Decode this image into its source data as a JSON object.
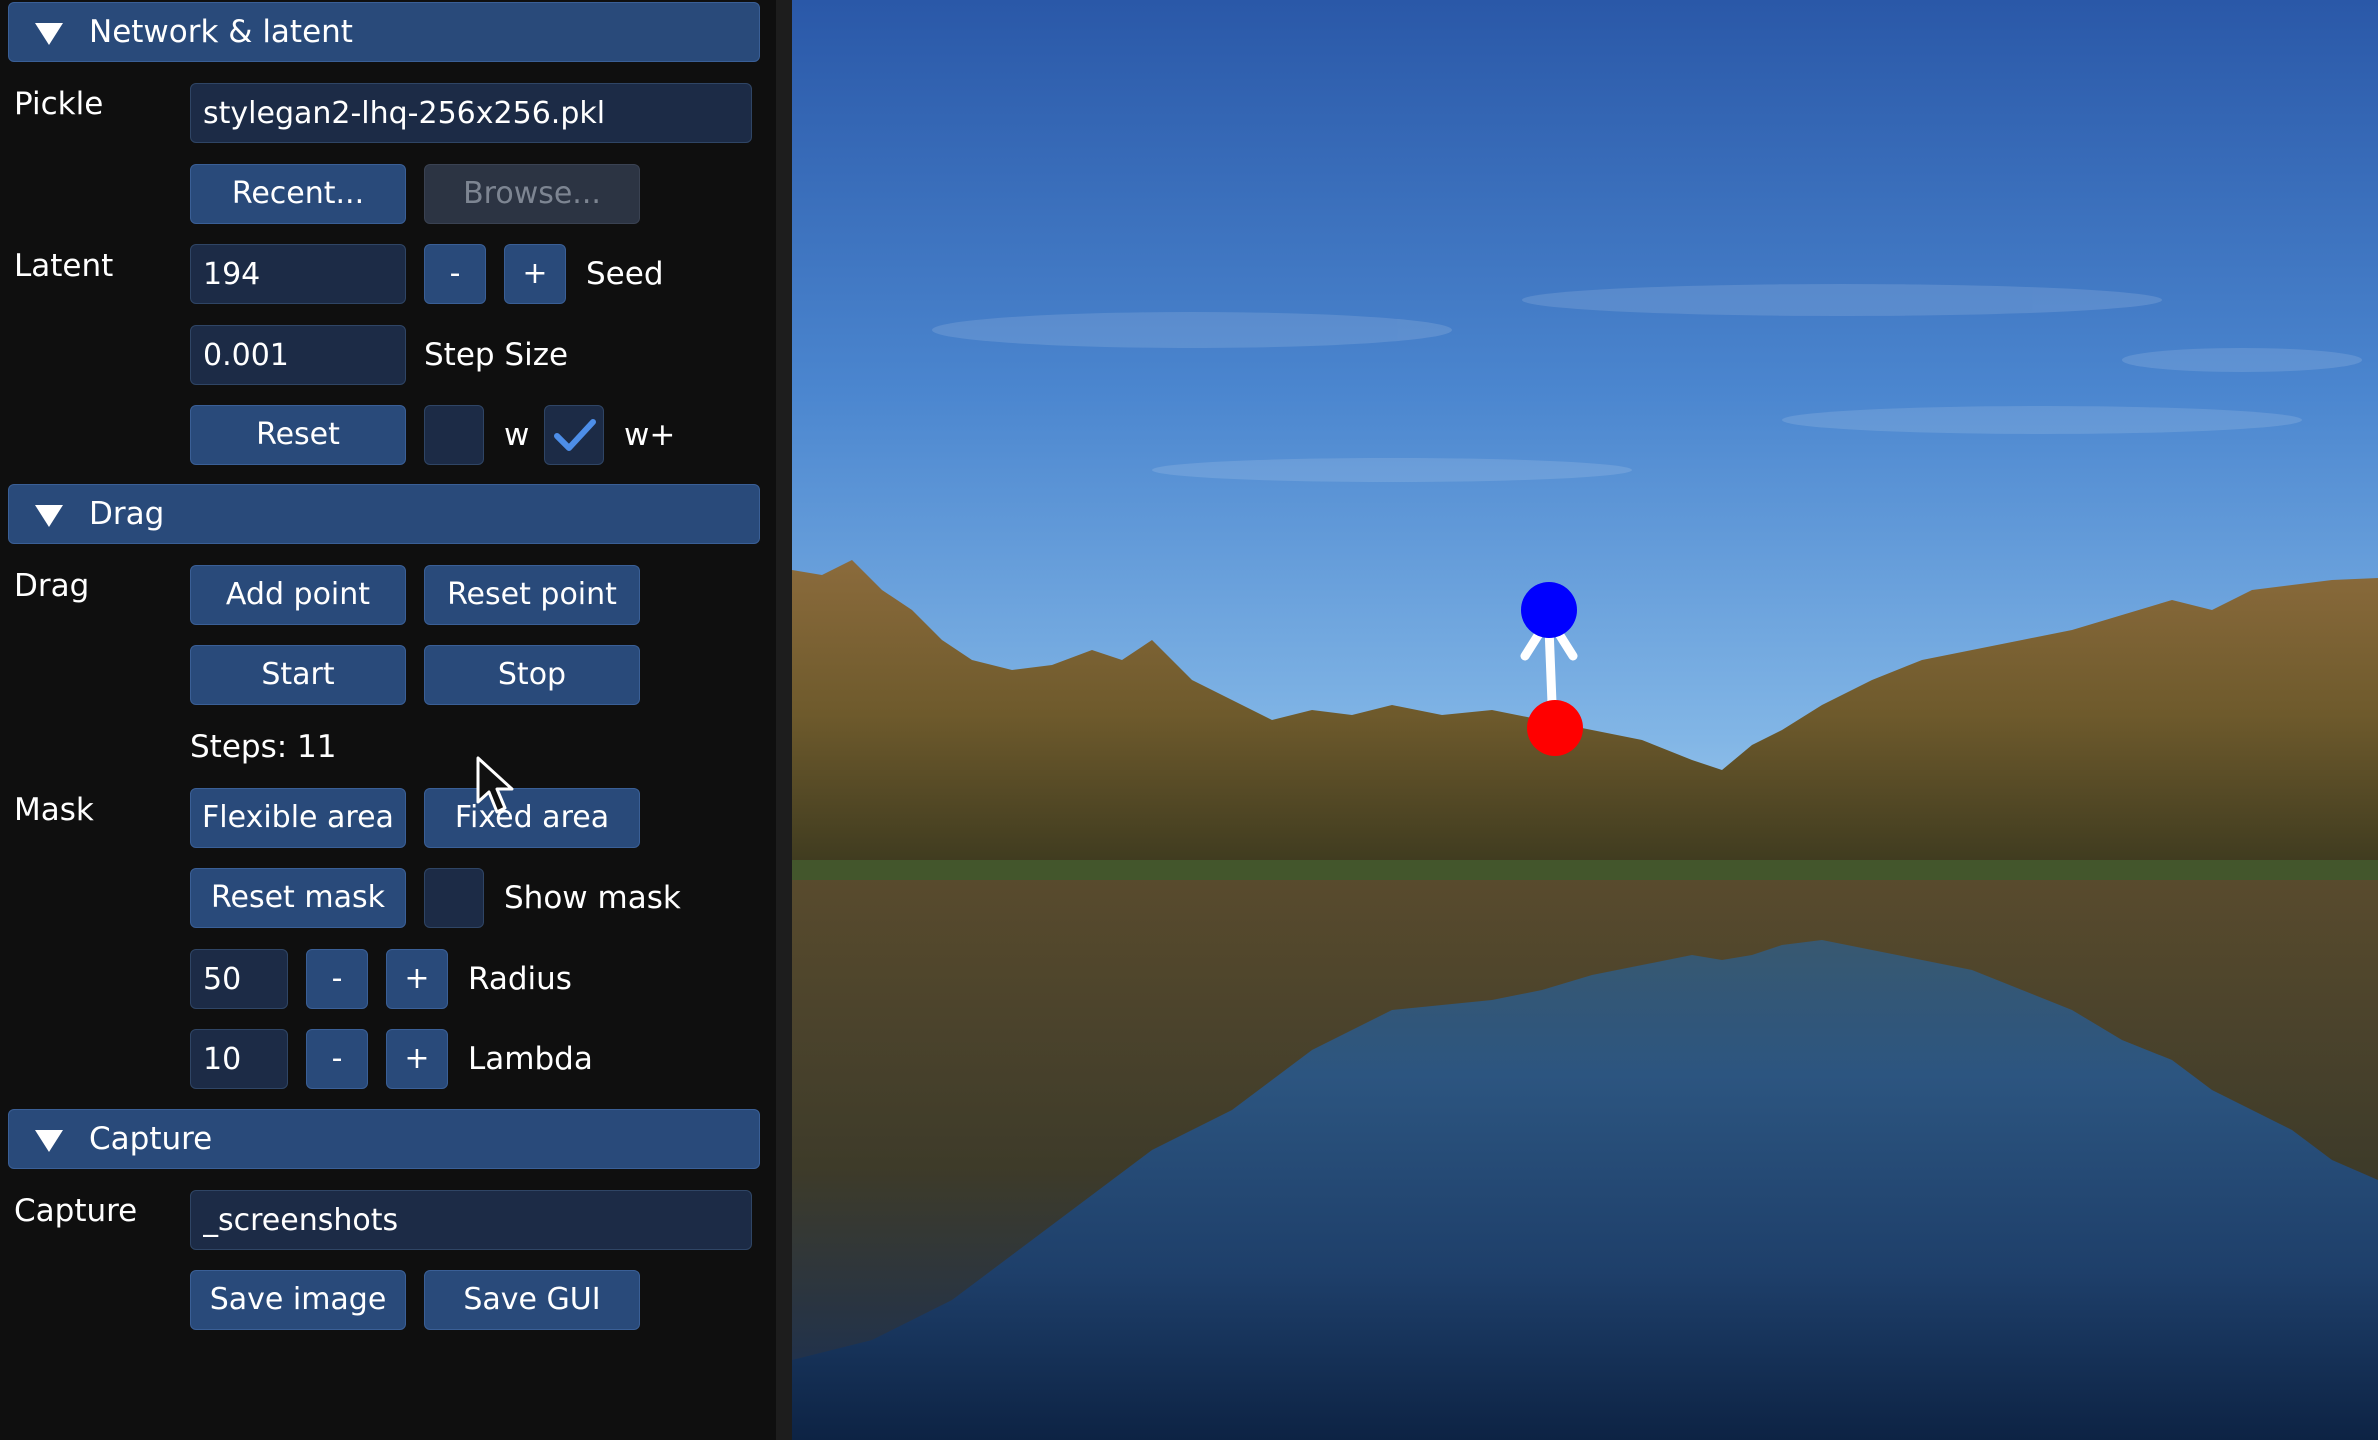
{
  "network": {
    "header": "Network & latent",
    "pickle_label": "Pickle",
    "pickle_value": "stylegan2-lhq-256x256.pkl",
    "recent_label": "Recent...",
    "browse_label": "Browse...",
    "latent_label": "Latent",
    "seed_value": "194",
    "minus_label": "-",
    "plus_label": "+",
    "seed_label": "Seed",
    "step_value": "0.001",
    "step_label": "Step Size",
    "reset_label": "Reset",
    "w_label": "w",
    "wplus_label": "w+",
    "w_checked": false,
    "wplus_checked": true
  },
  "drag": {
    "header": "Drag",
    "drag_label": "Drag",
    "add_point_label": "Add point",
    "reset_point_label": "Reset point",
    "start_label": "Start",
    "stop_label": "Stop",
    "steps_text": "Steps: 11",
    "mask_label": "Mask",
    "flexible_label": "Flexible area",
    "fixed_label": "Fixed area",
    "reset_mask_label": "Reset mask",
    "show_mask_label": "Show mask",
    "show_mask_checked": false,
    "radius_value": "50",
    "radius_label": "Radius",
    "lambda_value": "10",
    "lambda_label": "Lambda",
    "minus_label": "-",
    "plus_label": "+"
  },
  "capture": {
    "header": "Capture",
    "capture_label": "Capture",
    "path_value": "_screenshots",
    "save_image_label": "Save image",
    "save_gui_label": "Save GUI"
  },
  "viewport": {
    "handle_point_color": "#ff0000",
    "target_point_color": "#0000ff",
    "arrow_color": "#ffffff"
  },
  "colors": {
    "button": "#294a7a",
    "field": "#1c2b46",
    "panel_bg": "#0f0f0f",
    "check": "#4d8ee8"
  }
}
